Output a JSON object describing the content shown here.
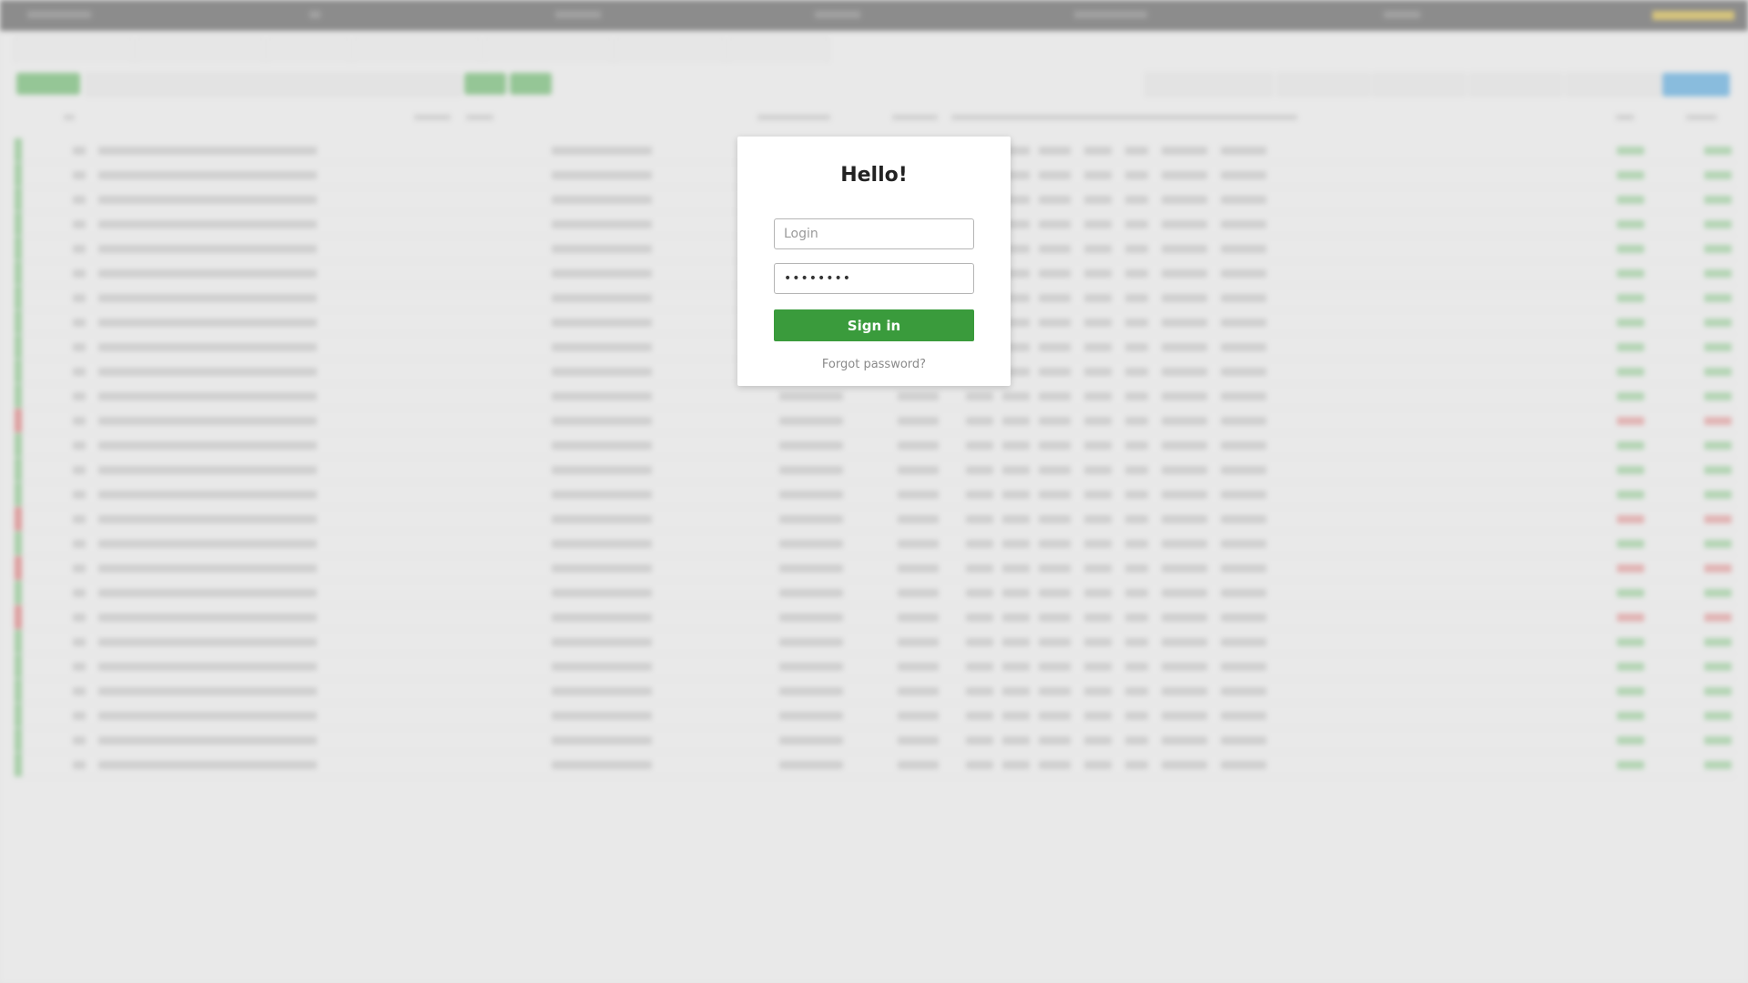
{
  "modal": {
    "title": "Hello!",
    "login_placeholder": "Login",
    "password_value": "password",
    "signin_label": "Sign in",
    "forgot_label": "Forgot password?"
  },
  "colors": {
    "signin_green": "#3a9b3c",
    "status_green": "#5bb55d",
    "status_red": "#d64545",
    "accent_blue": "#1d8ed8"
  },
  "background": {
    "tab_count": 7,
    "row_count": 26,
    "red_rows": [
      11,
      15,
      17,
      19
    ]
  }
}
